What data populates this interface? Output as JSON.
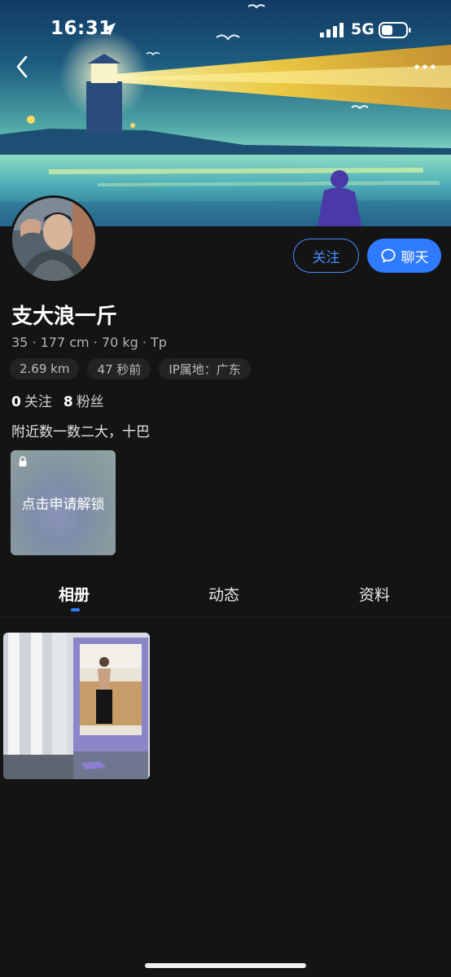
{
  "status_bar": {
    "time": "16:31",
    "network": "5G",
    "icons": [
      "location-arrow-icon",
      "signal-icon",
      "battery-icon"
    ]
  },
  "nav": {
    "back_icon": "chevron-left-icon",
    "more_icon": "more-dots-icon"
  },
  "profile": {
    "name": "支大浪一斤",
    "stats": "35 · 177 cm · 70 kg · Tp",
    "badges": {
      "distance": "2.69 km",
      "last_active": "47 秒前",
      "ip_location": "IP属地：广东"
    },
    "following_count": "0",
    "following_label": "关注",
    "followers_count": "8",
    "followers_label": "粉丝",
    "bio": "附近数一数二大，十巴"
  },
  "actions": {
    "follow_label": "关注",
    "chat_label": "聊天"
  },
  "locked_album": {
    "label": "点击申请解锁"
  },
  "tabs": {
    "album": "相册",
    "moments": "动态",
    "profile_info": "资料",
    "active": "相册"
  },
  "colors": {
    "background": "#141414",
    "accent_blue": "#2f7bff",
    "follow_outline": "#4a8dff",
    "badge_bg": "#232323"
  }
}
